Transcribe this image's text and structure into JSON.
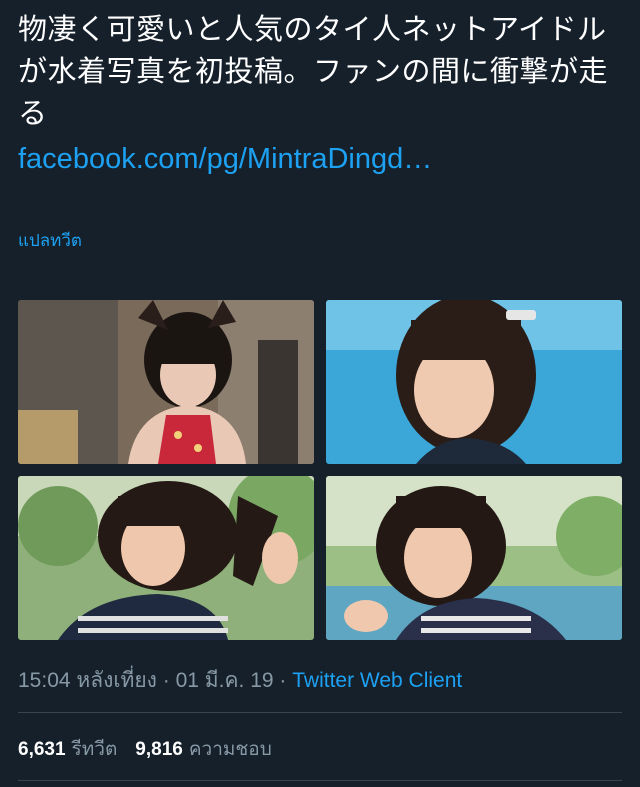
{
  "tweet": {
    "text": "物凄く可愛いと人気のタイ人ネットアイドルが水着写真を初投稿。ファンの間に衝撃が走る",
    "link": "facebook.com/pg/MintraDingd…",
    "translate_label": "แปลทวีต"
  },
  "media": {
    "photos": [
      {
        "icon": "photo-girl-cat-ears-red-dress"
      },
      {
        "icon": "photo-girl-pool"
      },
      {
        "icon": "photo-girl-hair-touch"
      },
      {
        "icon": "photo-girl-smile-waving"
      }
    ]
  },
  "meta": {
    "time": "15:04 หลังเที่ยง",
    "separator": " · ",
    "date": "01 มี.ค. 19",
    "client": "Twitter Web Client"
  },
  "stats": {
    "retweets": "6,631",
    "retweets_label": "รีทวีต",
    "likes": "9,816",
    "likes_label": "ความชอบ"
  },
  "colors": {
    "background": "#15202b",
    "link": "#1da1f2",
    "muted": "#8899a6",
    "divider": "#38444d"
  }
}
